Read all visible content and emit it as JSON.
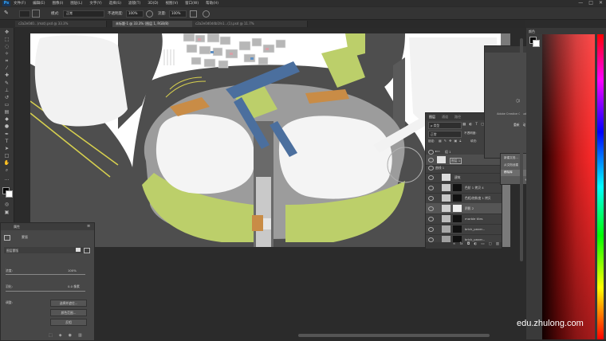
{
  "app": {
    "logo": "Ps"
  },
  "menu": [
    "文件(F)",
    "编辑(E)",
    "图像(I)",
    "图层(L)",
    "文字(Y)",
    "选择(S)",
    "滤镜(T)",
    "3D(D)",
    "视图(V)",
    "窗口(W)",
    "帮助(H)"
  ],
  "window_controls": [
    "—",
    "□",
    "✕"
  ],
  "options": {
    "mode_label": "模式:",
    "mode_value": "正常",
    "opacity_label": "不透明度:",
    "opacity_value": "100%",
    "flow_label": "流量:",
    "flow_value": "100%"
  },
  "tabs": [
    {
      "label": "c2a2e0d0...(mat).psd @ 33.3%",
      "active": false
    },
    {
      "label": "未标题-1 @ 33.3% (图层 1, RGB/8)",
      "active": true
    },
    {
      "label": "c2a2e0d0d4b1fe1...(1).psd @ 11.7%",
      "active": false
    }
  ],
  "layers_panel": {
    "tabs": [
      "图层",
      "通道",
      "路径"
    ],
    "kind_label": "ρ 类型",
    "blend_mode": "正常",
    "opacity_label": "不透明度:",
    "opacity_value": "100%",
    "fill_label": "填充:",
    "fill_value": "100%",
    "lock_label": "锁定:",
    "layers": [
      {
        "name": "组 1"
      },
      {
        "name": "图层 1"
      },
      {
        "name": "曲线 1"
      },
      {
        "name": "建筑"
      },
      {
        "name": "色阶 1 拷贝 4"
      },
      {
        "name": "色相/饱和度 1 拷贝"
      },
      {
        "name": "阴影 2"
      },
      {
        "name": "marble tiles"
      },
      {
        "name": "brick_paver..."
      },
      {
        "name": "brick_paver..."
      }
    ]
  },
  "libraries_panel": {
    "cloud_caption": "Adobe Creative Cloud Libraries 不可用",
    "link": "重新启动",
    "menu_items": [
      "新建文档...",
      "从文档创建",
      "移除库"
    ]
  },
  "properties_panel": {
    "title": "属性",
    "subtitle": "蒙版",
    "mask_label": "图层蒙版",
    "density_label": "浓度:",
    "density_value": "100%",
    "feather_label": "羽化:",
    "feather_value": "0.0 像素",
    "refine_label": "调整:",
    "buttons": [
      "选择并遮住...",
      "颜色范围...",
      "反相"
    ]
  },
  "color_panel": {
    "title": "颜色"
  },
  "watermark": "edu.zhulong.com",
  "colors": {
    "grass": "#bccf6a",
    "asphalt": "#4e4e4e",
    "gravel": "#9c9c9c",
    "blue_roof": "#4b6f9e",
    "orange_paving": "#c98c46",
    "road_line": "#d8d14e"
  }
}
